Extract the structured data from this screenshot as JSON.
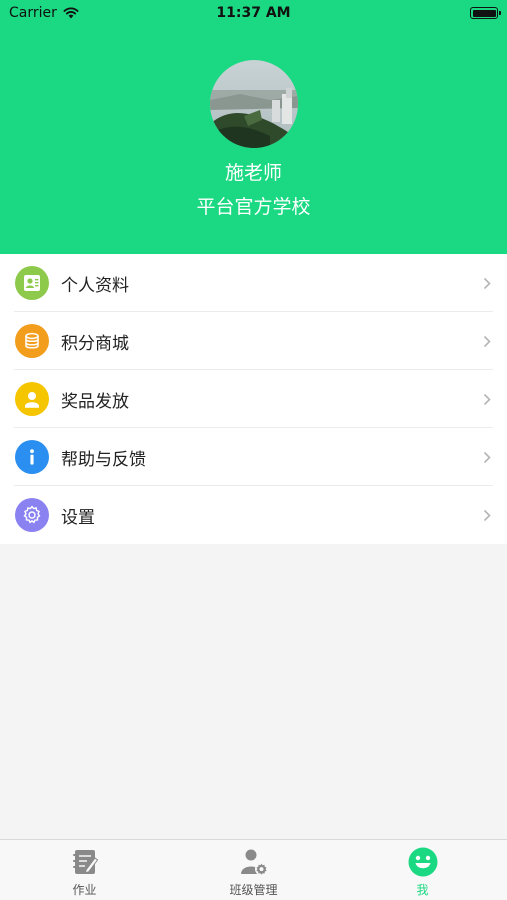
{
  "status_bar": {
    "carrier": "Carrier",
    "time": "11:37 AM"
  },
  "profile": {
    "name": "施老师",
    "school": "平台官方学校"
  },
  "menu": {
    "items": [
      {
        "label": "个人资料",
        "icon": "profile-card-icon",
        "color": "#8dc94a"
      },
      {
        "label": "积分商城",
        "icon": "coins-icon",
        "color": "#f29d1c"
      },
      {
        "label": "奖品发放",
        "icon": "prize-user-icon",
        "color": "#f5c500"
      },
      {
        "label": "帮助与反馈",
        "icon": "info-icon",
        "color": "#2a8ff0"
      },
      {
        "label": "设置",
        "icon": "gear-icon",
        "color": "#8a82f0"
      }
    ]
  },
  "tabbar": {
    "tabs": [
      {
        "label": "作业",
        "icon": "homework-icon",
        "active": false
      },
      {
        "label": "班级管理",
        "icon": "class-manage-icon",
        "active": false
      },
      {
        "label": "我",
        "icon": "me-smiley-icon",
        "active": true
      }
    ]
  },
  "colors": {
    "brand_green": "#1bd882",
    "background": "#f4f4f4"
  }
}
